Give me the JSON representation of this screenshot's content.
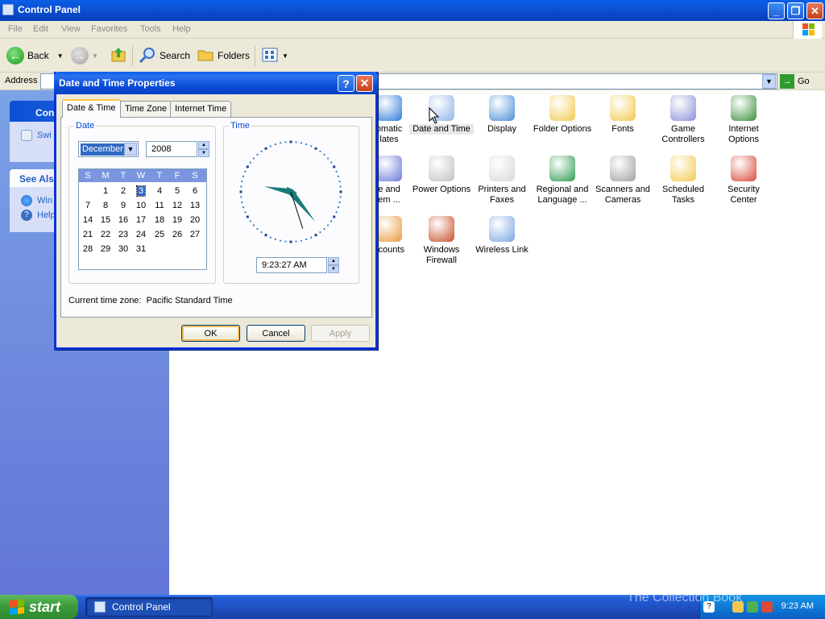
{
  "window": {
    "title": "Control Panel",
    "buttons": {
      "minimize": "_",
      "maximize": "❐",
      "close": "✕"
    }
  },
  "menu": [
    "File",
    "Edit",
    "View",
    "Favorites",
    "Tools",
    "Help"
  ],
  "toolbar": {
    "back_label": "Back",
    "search_label": "Search",
    "folders_label": "Folders"
  },
  "address": {
    "label": "Address",
    "go_label": "Go"
  },
  "taskpane": {
    "panel_title": "Con",
    "switch_link": "Swi",
    "see_also_title": "See Als",
    "links": [
      "Win",
      "Help"
    ]
  },
  "control_panel_items": [
    {
      "label": "omatic\nlates",
      "color": "#2c7bd8"
    },
    {
      "label": "Date and Time",
      "color": "#8fb3e8"
    },
    {
      "label": "Display",
      "color": "#4a8fd8"
    },
    {
      "label": "Folder Options",
      "color": "#f2c94c"
    },
    {
      "label": "Fonts",
      "color": "#f2c94c"
    },
    {
      "label": "Game\nControllers",
      "color": "#8b8fd8"
    },
    {
      "label": "Internet\nOptions",
      "color": "#3a8f3a"
    },
    {
      "label": "e and\nem ...",
      "color": "#6a7ad8"
    },
    {
      "label": "Power Options",
      "color": "#c0c0c0"
    },
    {
      "label": "Printers and\nFaxes",
      "color": "#d8d8d8"
    },
    {
      "label": "Regional and\nLanguage ...",
      "color": "#2f9b4f"
    },
    {
      "label": "Scanners and\nCameras",
      "color": "#a0a0a0"
    },
    {
      "label": "Scheduled\nTasks",
      "color": "#f2c94c"
    },
    {
      "label": "Security\nCenter",
      "color": "#d84a3a"
    },
    {
      "label": "ccounts",
      "color": "#e89a3a"
    },
    {
      "label": "Windows\nFirewall",
      "color": "#c8502a"
    },
    {
      "label": "Wireless Link",
      "color": "#7aa6e0"
    }
  ],
  "dialog": {
    "title": "Date and Time Properties",
    "help_btn": "?",
    "close_btn": "✕",
    "tabs": [
      "Date & Time",
      "Time Zone",
      "Internet Time"
    ],
    "date_group": "Date",
    "time_group": "Time",
    "month": "December",
    "year": "2008",
    "weekdays": [
      "S",
      "M",
      "T",
      "W",
      "T",
      "F",
      "S"
    ],
    "selected_day": "3",
    "days": [
      "1",
      "2",
      "3",
      "4",
      "5",
      "6",
      "7",
      "8",
      "9",
      "10",
      "11",
      "12",
      "13",
      "14",
      "15",
      "16",
      "17",
      "18",
      "19",
      "20",
      "21",
      "22",
      "23",
      "24",
      "25",
      "26",
      "27",
      "28",
      "29",
      "30",
      "31"
    ],
    "first_weekday_index": 1,
    "time": "9:23:27 AM",
    "clock": {
      "hour": 9,
      "minute": 23,
      "second": 27
    },
    "timezone_label": "Current time zone:",
    "timezone_value": "Pacific Standard Time",
    "ok": "OK",
    "cancel": "Cancel",
    "apply": "Apply"
  },
  "taskbar": {
    "start": "start",
    "task": "Control Panel",
    "clock": "9:23 AM",
    "watermark": "The Collection Book"
  }
}
